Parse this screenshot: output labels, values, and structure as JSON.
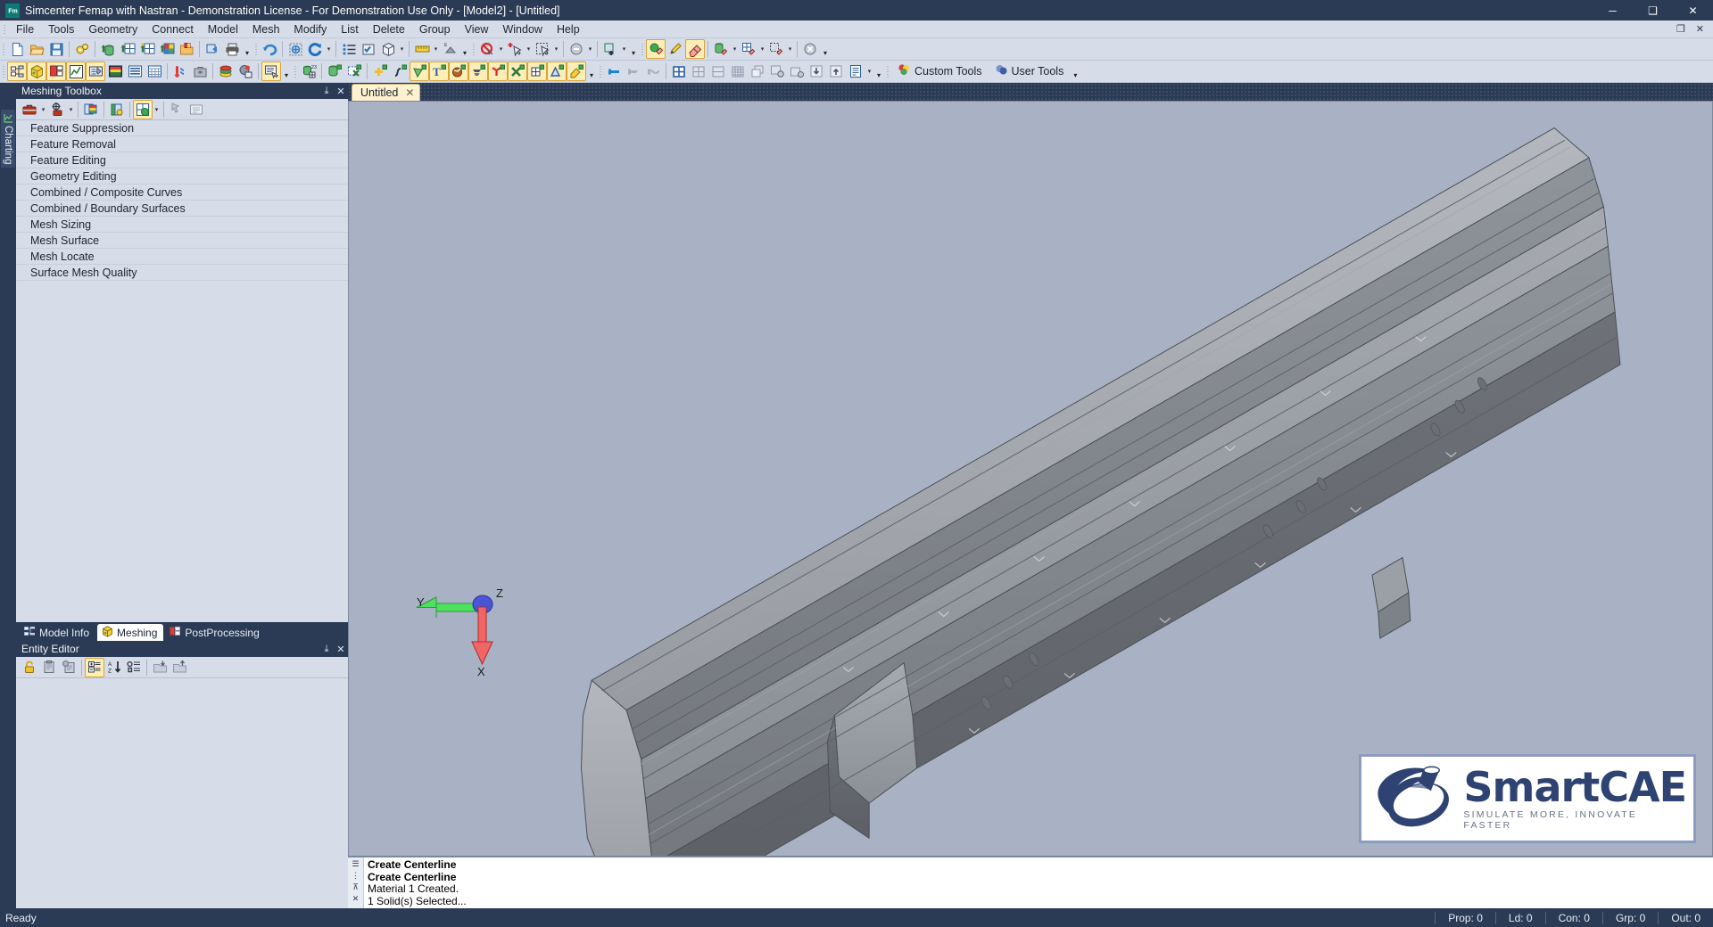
{
  "window": {
    "title": "Simcenter Femap with Nastran - Demonstration License - For Demonstration Use Only - [Model2] - [Untitled]",
    "app_icon": "femap-icon",
    "minimize": "─",
    "maximize": "❑",
    "close": "✕"
  },
  "menu": {
    "items": [
      "File",
      "Tools",
      "Geometry",
      "Connect",
      "Model",
      "Mesh",
      "Modify",
      "List",
      "Delete",
      "Group",
      "View",
      "Window",
      "Help"
    ],
    "mdi_restore": "❐",
    "mdi_close": "✕"
  },
  "toolbars": {
    "row1": [
      {
        "name": "new-file-icon",
        "kind": "icon"
      },
      {
        "name": "open-file-icon",
        "kind": "icon"
      },
      {
        "name": "save-file-icon",
        "kind": "icon"
      },
      {
        "name": "preferences-gears-icon",
        "kind": "icon"
      },
      {
        "name": "import-geometry-icon",
        "kind": "icon"
      },
      {
        "name": "mesh-import-icon",
        "kind": "icon"
      },
      {
        "name": "mesh-export-icon",
        "kind": "icon"
      },
      {
        "name": "color-mesh-icon",
        "kind": "icon"
      },
      {
        "name": "picture-save-icon",
        "kind": "icon"
      },
      {
        "name": "copy-picture-icon",
        "kind": "icon"
      },
      {
        "name": "print-icon",
        "kind": "icon"
      },
      {
        "name": "undo-icon",
        "kind": "icon"
      },
      {
        "name": "add-view-icon",
        "kind": "icon"
      },
      {
        "name": "rotate-view-icon",
        "kind": "icon"
      },
      {
        "name": "list-view-icon",
        "kind": "icon"
      },
      {
        "name": "view-options-icon",
        "kind": "icon"
      },
      {
        "name": "view-cube-icon",
        "kind": "icon"
      },
      {
        "name": "measure-ruler-icon",
        "kind": "icon"
      },
      {
        "name": "mass-props-icon",
        "kind": "icon"
      },
      {
        "name": "deselect-icon",
        "kind": "icon"
      },
      {
        "name": "add-select-icon",
        "kind": "icon"
      },
      {
        "name": "box-select-icon",
        "kind": "icon"
      },
      {
        "name": "unselect-all-icon",
        "kind": "icon"
      },
      {
        "name": "select-add-mesh-icon",
        "kind": "icon"
      },
      {
        "name": "point-erase-icon",
        "kind": "icon"
      },
      {
        "name": "pencil-icon",
        "kind": "icon"
      },
      {
        "name": "eraser-icon",
        "kind": "icon"
      },
      {
        "name": "solid-erase-icon",
        "kind": "icon"
      },
      {
        "name": "mesh-erase-icon",
        "kind": "icon"
      },
      {
        "name": "region-erase-icon",
        "kind": "icon"
      },
      {
        "name": "clear-icon",
        "kind": "icon"
      }
    ],
    "row2": [
      {
        "name": "model-info-icon",
        "kind": "icon"
      },
      {
        "name": "meshing-toolbox-icon",
        "kind": "icon"
      },
      {
        "name": "postprocessing-icon",
        "kind": "icon"
      },
      {
        "name": "chart-icon",
        "kind": "icon"
      },
      {
        "name": "entity-editor-icon",
        "kind": "icon"
      },
      {
        "name": "data-table-icon",
        "kind": "icon"
      },
      {
        "name": "data-surface-icon",
        "kind": "icon"
      },
      {
        "name": "api-table-icon",
        "kind": "icon"
      },
      {
        "name": "connection-icon",
        "kind": "icon"
      },
      {
        "name": "toolbox-icon",
        "kind": "icon"
      },
      {
        "name": "layers-icon",
        "kind": "icon"
      },
      {
        "name": "properties-icon",
        "kind": "icon"
      },
      {
        "name": "messages-icon",
        "kind": "icon"
      },
      {
        "name": "node-icon",
        "kind": "icon"
      },
      {
        "name": "solid-icon",
        "kind": "icon"
      },
      {
        "name": "mesh-x-icon",
        "kind": "icon"
      },
      {
        "name": "point-add-icon",
        "kind": "icon"
      },
      {
        "name": "curve-add-icon",
        "kind": "icon"
      },
      {
        "name": "surface-add-icon",
        "kind": "icon"
      },
      {
        "name": "text-add-icon",
        "kind": "icon"
      },
      {
        "name": "volume-add-icon",
        "kind": "icon"
      },
      {
        "name": "extrude-add-icon",
        "kind": "icon"
      },
      {
        "name": "axis-add-icon",
        "kind": "icon"
      },
      {
        "name": "cross-add-icon",
        "kind": "icon"
      },
      {
        "name": "grid-add-icon",
        "kind": "icon"
      },
      {
        "name": "triangle-add-icon",
        "kind": "icon"
      },
      {
        "name": "paint-add-icon",
        "kind": "icon"
      },
      {
        "name": "show-entity-icon",
        "kind": "icon"
      },
      {
        "name": "hide-entity-icon",
        "kind": "icon"
      },
      {
        "name": "hide-others-icon",
        "kind": "icon"
      },
      {
        "name": "window-4-icon",
        "kind": "icon"
      },
      {
        "name": "window-tile-icon",
        "kind": "icon"
      },
      {
        "name": "window-split-icon",
        "kind": "icon"
      },
      {
        "name": "window-grid-icon",
        "kind": "icon"
      },
      {
        "name": "window-cascade-icon",
        "kind": "icon"
      },
      {
        "name": "view-gear-icon",
        "kind": "icon"
      },
      {
        "name": "view-gear2-icon",
        "kind": "icon"
      },
      {
        "name": "download-icon",
        "kind": "icon"
      },
      {
        "name": "upload-icon",
        "kind": "icon"
      },
      {
        "name": "report-icon",
        "kind": "icon"
      }
    ],
    "custom_tools_label": "Custom Tools",
    "user_tools_label": "User Tools"
  },
  "vertical_tab": {
    "label": "Charting",
    "icon": "charting-icon"
  },
  "meshing_toolbox": {
    "title": "Meshing Toolbox",
    "pin": "⤓",
    "close": "✕",
    "toolbar_icons": [
      "toolbox-red-icon",
      "toolbox-caret",
      "target-toolbox-icon",
      "target-caret",
      "color-palette-icon",
      "mesh-highlight-icon",
      "mesh-green-icon",
      "mesh-green-caret",
      "pick-cursor-icon",
      "list-panel-icon"
    ],
    "items": [
      "Feature Suppression",
      "Feature Removal",
      "Feature Editing",
      "Geometry Editing",
      "Combined / Composite Curves",
      "Combined / Boundary Surfaces",
      "Mesh Sizing",
      "Mesh Surface",
      "Mesh Locate",
      "Surface Mesh Quality"
    ]
  },
  "dock_tabs": [
    {
      "label": "Model Info",
      "icon": "model-info-icon",
      "active": false
    },
    {
      "label": "Meshing",
      "icon": "meshing-cube-icon",
      "active": true
    },
    {
      "label": "PostProcessing",
      "icon": "postprocessing-icon",
      "active": false
    }
  ],
  "entity_editor": {
    "title": "Entity Editor",
    "pin": "⤓",
    "close": "✕",
    "toolbar_icons": [
      "lock-icon",
      "paste-icon",
      "paste-special-icon",
      "categorize-icon",
      "sort-az-icon",
      "group-list-icon",
      "load-icon",
      "save-icon"
    ]
  },
  "document_tab": {
    "label": "Untitled",
    "close": "✕"
  },
  "viewport": {
    "background_color": "#a8b2c4",
    "model_name": "extruded-aluminium-beam-profile",
    "axes": [
      {
        "label": "Y",
        "color": "#2fd24a",
        "dir": "left"
      },
      {
        "label": "Z",
        "color": "#3b48c8",
        "dir": "up-right"
      },
      {
        "label": "X",
        "color": "#e8403a",
        "dir": "down"
      }
    ],
    "axis_label_y": "Y",
    "axis_label_z": "Z",
    "axis_label_x": "X"
  },
  "logo": {
    "word_smart": "Smart",
    "word_cae": "CAE",
    "tagline": "SIMULATE MORE, INNOVATE FASTER"
  },
  "messages": {
    "lines": [
      {
        "text": "Create Centerline",
        "bold": true
      },
      {
        "text": "Create Centerline",
        "bold": true
      },
      {
        "text": "Material 1 Created.",
        "bold": false
      },
      {
        "text": "1 Solid(s) Selected...",
        "bold": false
      }
    ],
    "gutter_icons": [
      "messages-icon",
      "grip-icon",
      "pin-icon",
      "close-icon"
    ]
  },
  "statusbar": {
    "ready": "Ready",
    "cells": [
      "Prop: 0",
      "Ld: 0",
      "Con: 0",
      "Grp: 0",
      "Out: 0"
    ]
  }
}
